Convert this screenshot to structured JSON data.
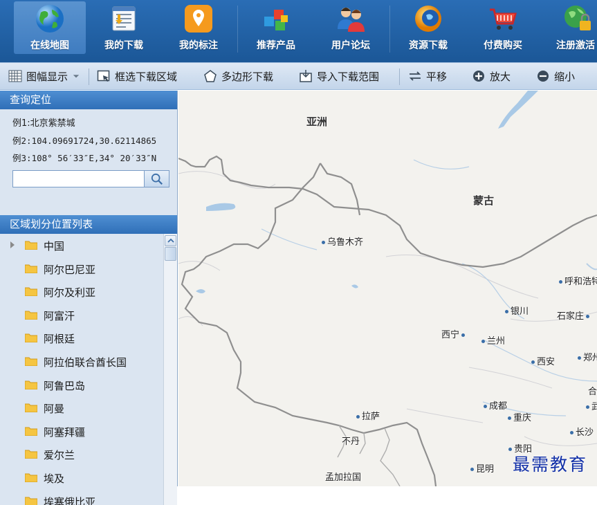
{
  "nav": {
    "items": [
      {
        "label": "在线地图",
        "icon": "globe-icon",
        "active": true
      },
      {
        "label": "我的下载",
        "icon": "download-list-icon"
      },
      {
        "label": "我的标注",
        "icon": "map-pin-icon"
      },
      {
        "label": "推荐产品",
        "icon": "cubes-icon"
      },
      {
        "label": "用户论坛",
        "icon": "users-icon"
      },
      {
        "label": "资源下载",
        "icon": "resource-globe-icon"
      },
      {
        "label": "付费购买",
        "icon": "shopping-cart-icon"
      },
      {
        "label": "注册激活",
        "icon": "lock-globe-icon"
      }
    ]
  },
  "toolbar": {
    "frame_display": "图幅显示",
    "box_download": "框选下载区域",
    "polygon_download": "多边形下载",
    "import_range": "导入下载范围",
    "pan": "平移",
    "zoom_in": "放大",
    "zoom_out": "缩小"
  },
  "query": {
    "title": "查询定位",
    "example1": "例1:北京紫禁城",
    "example2": "例2:104.09691724,30.62114865",
    "example3": "例3:108° 56′33″E,34° 20′33″N",
    "input_value": "",
    "input_placeholder": ""
  },
  "region_list": {
    "title": "区域划分位置列表",
    "items": [
      "中国",
      "阿尔巴尼亚",
      "阿尔及利亚",
      "阿富汗",
      "阿根廷",
      "阿拉伯联合酋长国",
      "阿鲁巴岛",
      "阿曼",
      "阿塞拜疆",
      "爱尔兰",
      "埃及",
      "埃塞俄比亚"
    ]
  },
  "map": {
    "labels": {
      "asia": "亚洲",
      "mongolia": "蒙古",
      "urumqi": "乌鲁木齐",
      "hohhot": "呼和浩特",
      "yinchuan": "银川",
      "shijiazhuang": "石家庄",
      "xining": "西宁",
      "lanzhou": "兰州",
      "xian": "西安",
      "zhengzhou": "郑州",
      "chengdu": "成都",
      "chongqing": "重庆",
      "wuhan": "武",
      "lhasa": "拉萨",
      "bhutan": "不丹",
      "changsha": "长沙",
      "guiyang": "贵阳",
      "kunming": "昆明",
      "bangladesh": "孟加拉国",
      "partial_right": "合"
    },
    "watermark": "最需教育"
  }
}
